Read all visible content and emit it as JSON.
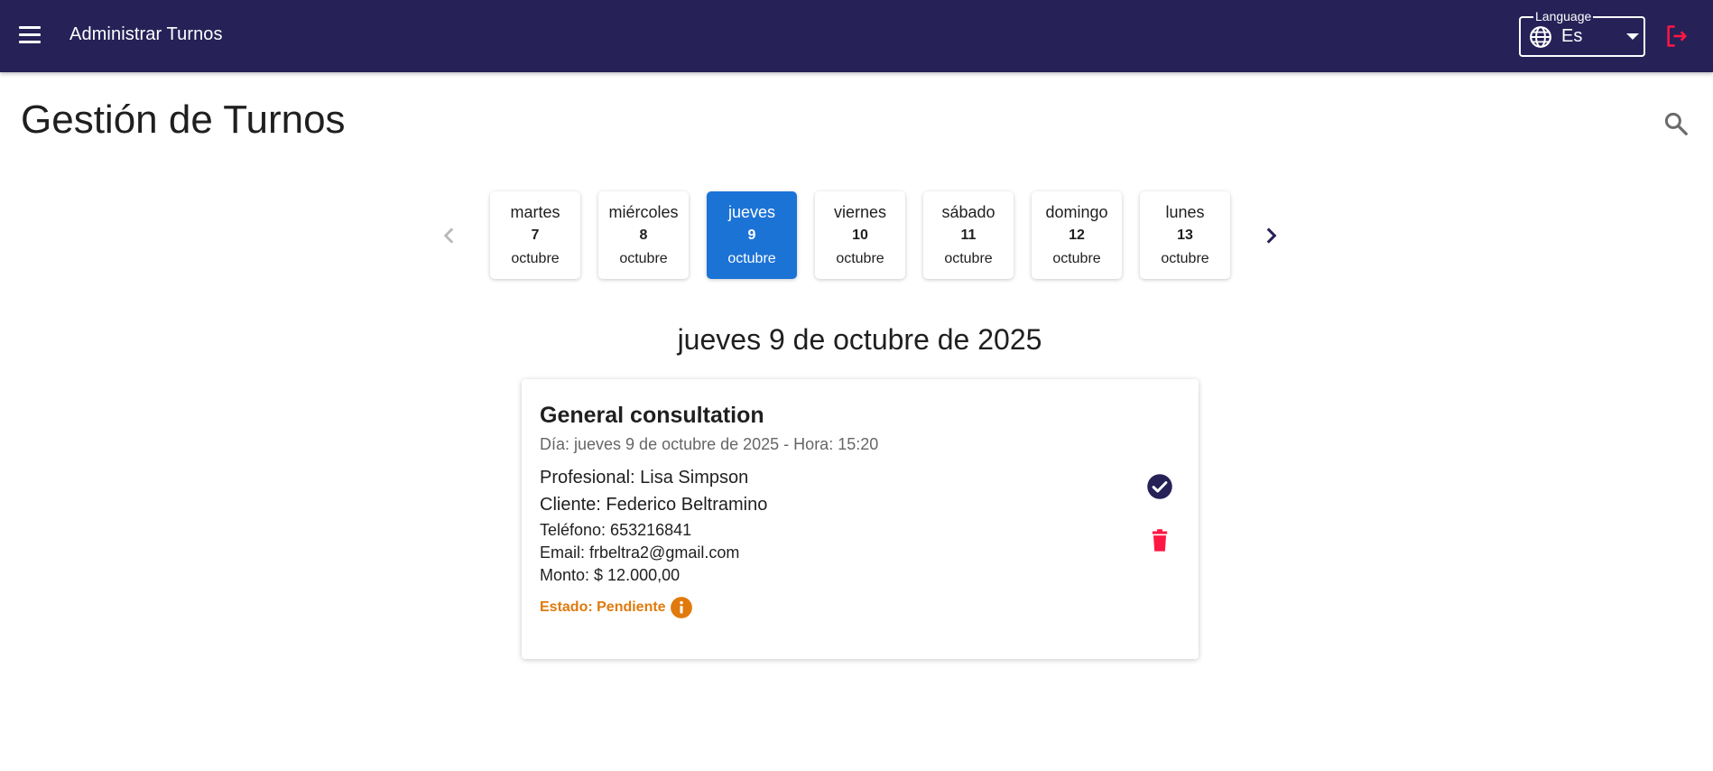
{
  "appbar": {
    "title": "Administrar Turnos",
    "language_label": "Language",
    "language_value": "Es",
    "icons": [
      "menu-icon",
      "globe-icon",
      "caret-down-icon",
      "logout-icon"
    ],
    "background": "#262157",
    "logout_color": "#ff1744"
  },
  "page": {
    "title": "Gestión de Turnos",
    "search_icon": "search-icon"
  },
  "days": [
    {
      "name": "martes",
      "number": "7",
      "month": "octubre",
      "selected": false
    },
    {
      "name": "miércoles",
      "number": "8",
      "month": "octubre",
      "selected": false
    },
    {
      "name": "jueves",
      "number": "9",
      "month": "octubre",
      "selected": true
    },
    {
      "name": "viernes",
      "number": "10",
      "month": "octubre",
      "selected": false
    },
    {
      "name": "sábado",
      "number": "11",
      "month": "octubre",
      "selected": false
    },
    {
      "name": "domingo",
      "number": "12",
      "month": "octubre",
      "selected": false
    },
    {
      "name": "lunes",
      "number": "13",
      "month": "octubre",
      "selected": false
    }
  ],
  "selected_day_color": "#1c73d6",
  "selected_date": "jueves 9 de octubre de 2025",
  "appointment": {
    "title": "General consultation",
    "subtitle": "Día: jueves 9 de octubre de 2025 - Hora: 15:20",
    "professional": "Profesional: Lisa Simpson",
    "client": "Cliente: Federico Beltramino",
    "phone": "Teléfono: 653216841",
    "email": "Email: frbeltra2@gmail.com",
    "amount": "Monto: $ 12.000,00",
    "status": "Estado: Pendiente",
    "status_color": "#e07a0c",
    "confirm_color": "#262157",
    "delete_color": "#ff1744"
  }
}
